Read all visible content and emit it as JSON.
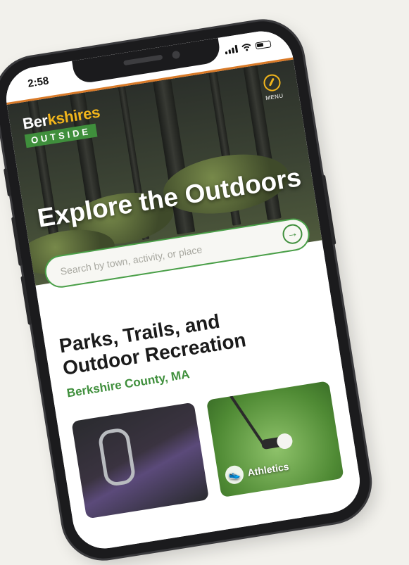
{
  "status_bar": {
    "time": "2:58"
  },
  "brand": {
    "logo_part1": "Ber",
    "logo_part2": "kshires",
    "logo_sub": "OUTSIDE",
    "accent_color": "#f1b51c",
    "green_color": "#3f8f3c",
    "orange_color": "#d97a28"
  },
  "header": {
    "menu_label": "MENU",
    "menu_icon": "compass-icon"
  },
  "hero": {
    "title": "Explore the Outdoors"
  },
  "search": {
    "placeholder": "Search by town, activity, or place",
    "submit_icon": "arrow-right-circle-icon"
  },
  "section": {
    "title": "Parks, Trails, and Outdoor Recreation",
    "subtitle": "Berkshire County, MA"
  },
  "cards": [
    {
      "label": "",
      "icon": "carabiner-image"
    },
    {
      "label": "Athletics",
      "icon": "sneaker-icon"
    }
  ]
}
